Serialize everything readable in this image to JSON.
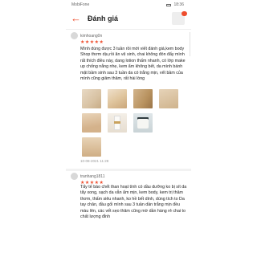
{
  "status_bar": {
    "carrier": "MobiFone",
    "time": "18:36"
  },
  "header": {
    "title": "Đánh giá",
    "cart_count": ""
  },
  "reviews": [
    {
      "username": "kimhoang0n",
      "stars": "★★★★★",
      "text": "Mình dùng được 3 tuần rồi mới viết đánh giá,kem body Shop thơm dịu,rồi ăn vệ sinh, chai không đón đẩy mình rất thích điều này, dang lotion thấm nhanh, có lớp make up chống nắng nhẹ, kem ẩm không bết, da mình bánh mặt bầm sinh sau 3 tuần da có trắng mịn, vết bầm của mình cũng giảm thâm, rất hài lòng",
      "date": "10-08-2021 11:28"
    },
    {
      "username": "tranhang1811",
      "stars": "★★★★★",
      "text": "Tẩy tế bào chết than hoạt tính có dầu dưỡng ko bị sít da tẩy xong, sạch da vẫn ẩm mịn, kem body, kem trị thâm thơm, thấm siêu nhanh, ko hề bết dính, dùng tích to Da tay chân, đầu gối mình sau 3 tuần dần trắng mịn đều màu lên, các vết sẹo thâm cũng mờ dần hàng rẻ chai to chất lượng đỉnh"
    }
  ]
}
